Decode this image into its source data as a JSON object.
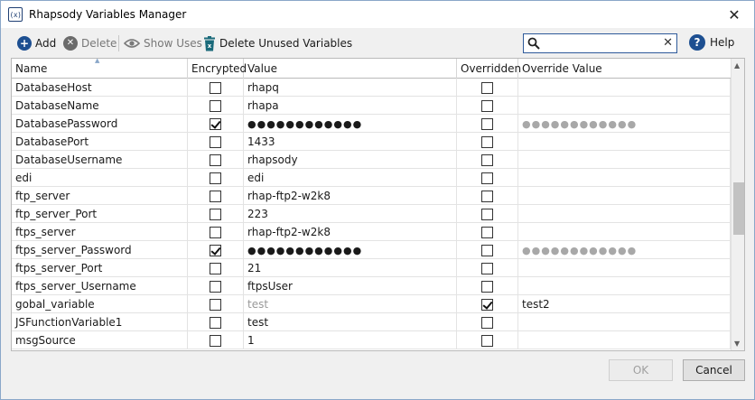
{
  "window": {
    "title": "Rhapsody Variables Manager",
    "icon_text": "(x)",
    "close_glyph": "✕"
  },
  "toolbar": {
    "add_label": "Add",
    "delete_label": "Delete",
    "show_uses_label": "Show Uses",
    "delete_unused_label": "Delete Unused Variables",
    "help_label": "Help"
  },
  "search": {
    "value": "",
    "placeholder": "",
    "clear_glyph": "✕"
  },
  "table": {
    "columns": [
      "Name",
      "Encrypted",
      "Value",
      "Overridden",
      "Override Value"
    ],
    "rows": [
      {
        "name": "DatabaseHost",
        "encrypted": false,
        "value": "rhapq",
        "overridden": false,
        "override_value": ""
      },
      {
        "name": "DatabaseName",
        "encrypted": false,
        "value": "rhapa",
        "overridden": false,
        "override_value": ""
      },
      {
        "name": "DatabasePassword",
        "encrypted": true,
        "value": "●●●●●●●●●●●●",
        "overridden": false,
        "override_value": "●●●●●●●●●●●●"
      },
      {
        "name": "DatabasePort",
        "encrypted": false,
        "value": "1433",
        "overridden": false,
        "override_value": ""
      },
      {
        "name": "DatabaseUsername",
        "encrypted": false,
        "value": "rhapsody",
        "overridden": false,
        "override_value": ""
      },
      {
        "name": "edi",
        "encrypted": false,
        "value": "edi",
        "overridden": false,
        "override_value": ""
      },
      {
        "name": "ftp_server",
        "encrypted": false,
        "value": "rhap-ftp2-w2k8",
        "overridden": false,
        "override_value": ""
      },
      {
        "name": "ftp_server_Port",
        "encrypted": false,
        "value": "223",
        "overridden": false,
        "override_value": ""
      },
      {
        "name": "ftps_server",
        "encrypted": false,
        "value": "rhap-ftp2-w2k8",
        "overridden": false,
        "override_value": ""
      },
      {
        "name": "ftps_server_Password",
        "encrypted": true,
        "value": "●●●●●●●●●●●●",
        "overridden": false,
        "override_value": "●●●●●●●●●●●●"
      },
      {
        "name": "ftps_server_Port",
        "encrypted": false,
        "value": "21",
        "overridden": false,
        "override_value": ""
      },
      {
        "name": "ftps_server_Username",
        "encrypted": false,
        "value": "ftpsUser",
        "overridden": false,
        "override_value": ""
      },
      {
        "name": "gobal_variable",
        "encrypted": false,
        "value": "test",
        "overridden": true,
        "override_value": "test2"
      },
      {
        "name": "JSFunctionVariable1",
        "encrypted": false,
        "value": "test",
        "overridden": false,
        "override_value": ""
      },
      {
        "name": "msgSource",
        "encrypted": false,
        "value": "1",
        "overridden": false,
        "override_value": ""
      }
    ]
  },
  "buttons": {
    "ok_label": "OK",
    "cancel_label": "Cancel"
  },
  "colors": {
    "accent": "#1d4f91",
    "muted_text": "#999999"
  },
  "icons": [
    "add-icon",
    "delete-icon",
    "eye-icon",
    "trash-icon",
    "search-icon",
    "help-icon"
  ]
}
